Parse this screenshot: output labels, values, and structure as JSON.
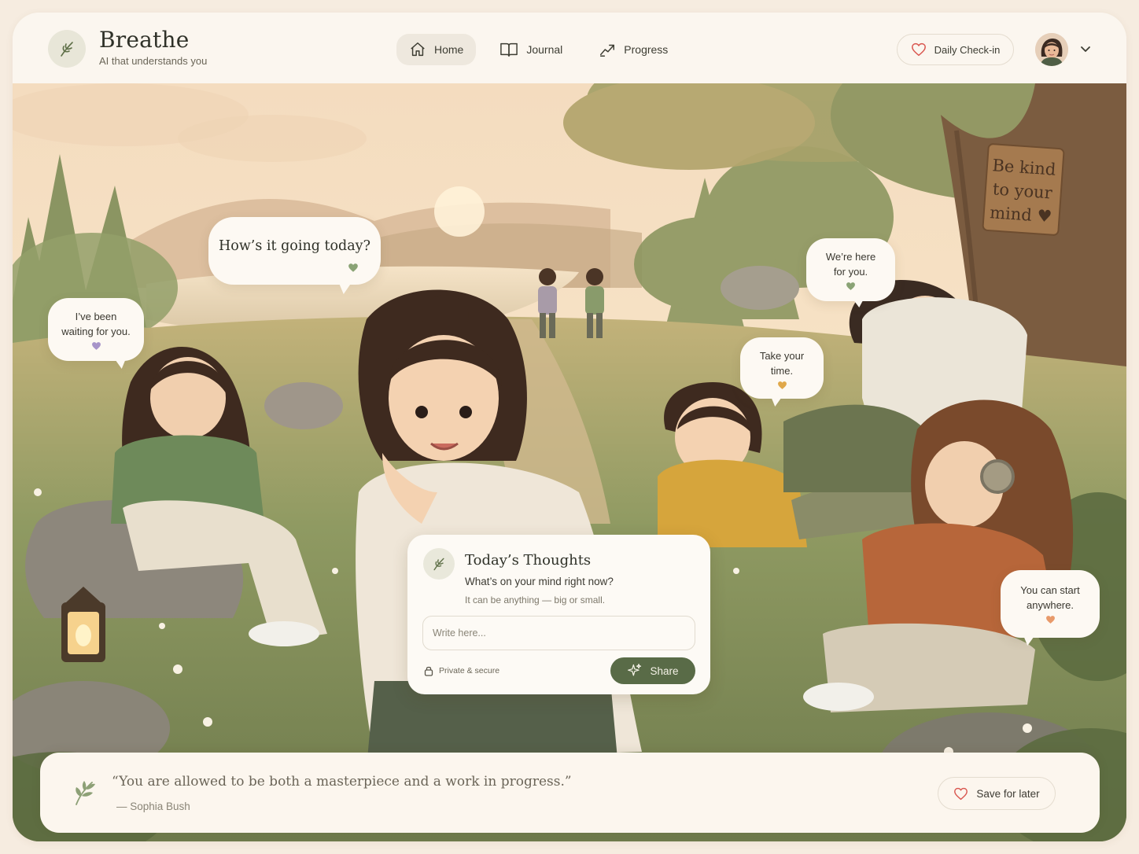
{
  "brand": {
    "title": "Breathe",
    "subtitle": "AI that understands you",
    "logo_icon": "leaf-icon"
  },
  "nav": {
    "items": [
      {
        "label": "Home",
        "icon": "home-icon",
        "active": true
      },
      {
        "label": "Journal",
        "icon": "book-icon",
        "active": false
      },
      {
        "label": "Progress",
        "icon": "trend-icon",
        "active": false
      }
    ]
  },
  "header": {
    "checkin_label": "Daily Check-in",
    "checkin_icon": "heart-icon",
    "profile_menu_icon": "chevron-down-icon"
  },
  "scene": {
    "sign_text": [
      "Be kind",
      "to your",
      "mind ♥"
    ],
    "bubbles": [
      {
        "text": "How’s it going today?",
        "heart_color": "#8aa375"
      },
      {
        "text_lines": [
          "I’ve been",
          "waiting for you."
        ],
        "heart_color": "#a794c9"
      },
      {
        "text_lines": [
          "We’re here",
          "for you."
        ],
        "heart_color": "#8aa375"
      },
      {
        "text_lines": [
          "Take your",
          "time."
        ],
        "heart_color": "#e0a84a"
      },
      {
        "text_lines": [
          "You can start",
          "anywhere."
        ],
        "heart_color": "#e89a6a"
      }
    ]
  },
  "card": {
    "title": "Today’s Thoughts",
    "question": "What’s on your mind right now?",
    "hint": "It can be anything — big or small.",
    "input_placeholder": "Write here...",
    "input_value": "",
    "privacy_label": "Private & secure",
    "share_label": "Share"
  },
  "quote": {
    "text": "“You are allowed to be both a masterpiece and a work in progress.”",
    "author": "— Sophia Bush",
    "save_label": "Save for later"
  },
  "colors": {
    "accent_green": "#596b47",
    "heart_red": "#d9564f",
    "background": "#f6ece0"
  }
}
